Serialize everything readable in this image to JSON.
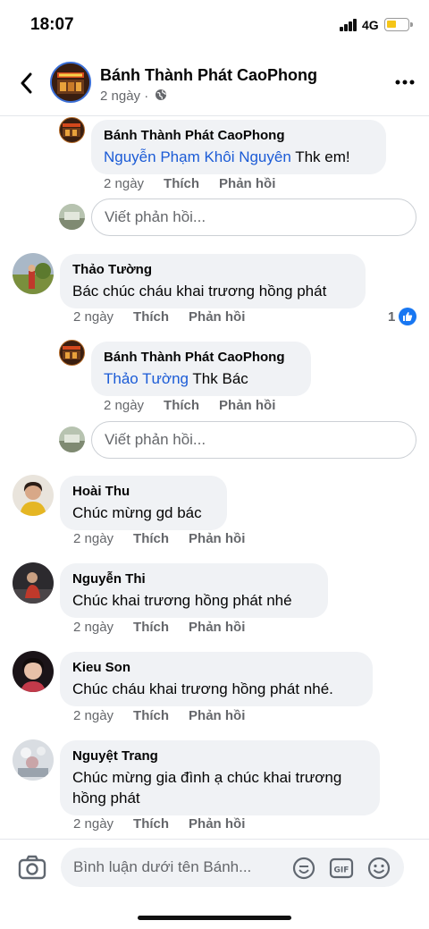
{
  "status_bar": {
    "time": "18:07",
    "network": "4G"
  },
  "header": {
    "page_name": "Bánh Thành Phát CaoPhong",
    "post_time": "2 ngày ·"
  },
  "comments": [
    {
      "name": "Bánh Thành Phát CaoPhong",
      "mention": "Nguyễn Phạm Khôi Nguyên",
      "text": " Thk em!",
      "time": "2 ngày",
      "like": "Thích",
      "reply": "Phản hồi"
    },
    {
      "reply_placeholder": "Viết phản hồi..."
    },
    {
      "name": "Thảo Tường",
      "text": "Bác chúc cháu khai trương hồng phát",
      "time": "2 ngày",
      "like": "Thích",
      "reply": "Phản hồi",
      "likes_count": "1"
    },
    {
      "name": "Bánh Thành Phát CaoPhong",
      "mention": "Thảo Tường",
      "text": " Thk Bác",
      "time": "2 ngày",
      "like": "Thích",
      "reply": "Phản hồi"
    },
    {
      "reply_placeholder": "Viết phản hồi..."
    },
    {
      "name": "Hoài Thu",
      "text": "Chúc mừng gd bác",
      "time": "2 ngày",
      "like": "Thích",
      "reply": "Phản hồi"
    },
    {
      "name": "Nguyễn Thi",
      "text": "Chúc khai trương hồng phát nhé",
      "time": "2 ngày",
      "like": "Thích",
      "reply": "Phản hồi"
    },
    {
      "name": "Kieu Son",
      "text": "Chúc cháu khai trương hồng phát nhé.",
      "time": "2 ngày",
      "like": "Thích",
      "reply": "Phản hồi"
    },
    {
      "name": "Nguyệt Trang",
      "text": "Chúc mừng gia đình ạ chúc khai trương hồng phát",
      "time": "2 ngày",
      "like": "Thích",
      "reply": "Phản hồi"
    }
  ],
  "composer": {
    "placeholder": "Bình luận dưới tên Bánh..."
  },
  "colors": {
    "mention": "#1b5bd6",
    "like_badge": "#1877f2",
    "bubble": "#f0f2f5",
    "secondary_text": "#65676b"
  },
  "icons": [
    "back-arrow-icon",
    "globe-icon",
    "more-icon",
    "like-thumb-icon",
    "camera-icon",
    "sticker-icon",
    "gif-icon",
    "emoji-icon"
  ]
}
